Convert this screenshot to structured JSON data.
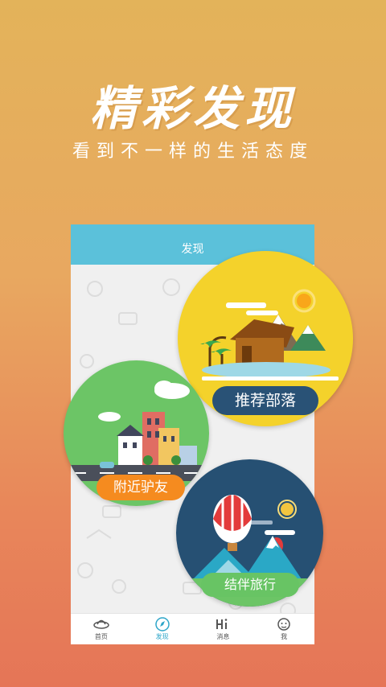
{
  "headline": "精彩发现",
  "subline": "看到不一样的生活态度",
  "screen": {
    "title": "发现",
    "cards": {
      "tribe": "推荐部落",
      "nearby": "附近驴友",
      "travel": "结伴旅行"
    },
    "tabs": [
      {
        "label": "首页",
        "icon": "ufo-icon"
      },
      {
        "label": "发现",
        "icon": "compass-icon"
      },
      {
        "label": "消息",
        "icon": "hi-icon"
      },
      {
        "label": "我",
        "icon": "face-icon"
      }
    ],
    "active_tab": "发现"
  },
  "colors": {
    "header": "#5bc1da",
    "tribe_bg": "#f4d22b",
    "nearby_bg": "#6cc566",
    "travel_bg": "#265073",
    "pill_tribe": "#295276",
    "pill_nearby": "#f58b1f",
    "pill_travel": "#68c464"
  }
}
